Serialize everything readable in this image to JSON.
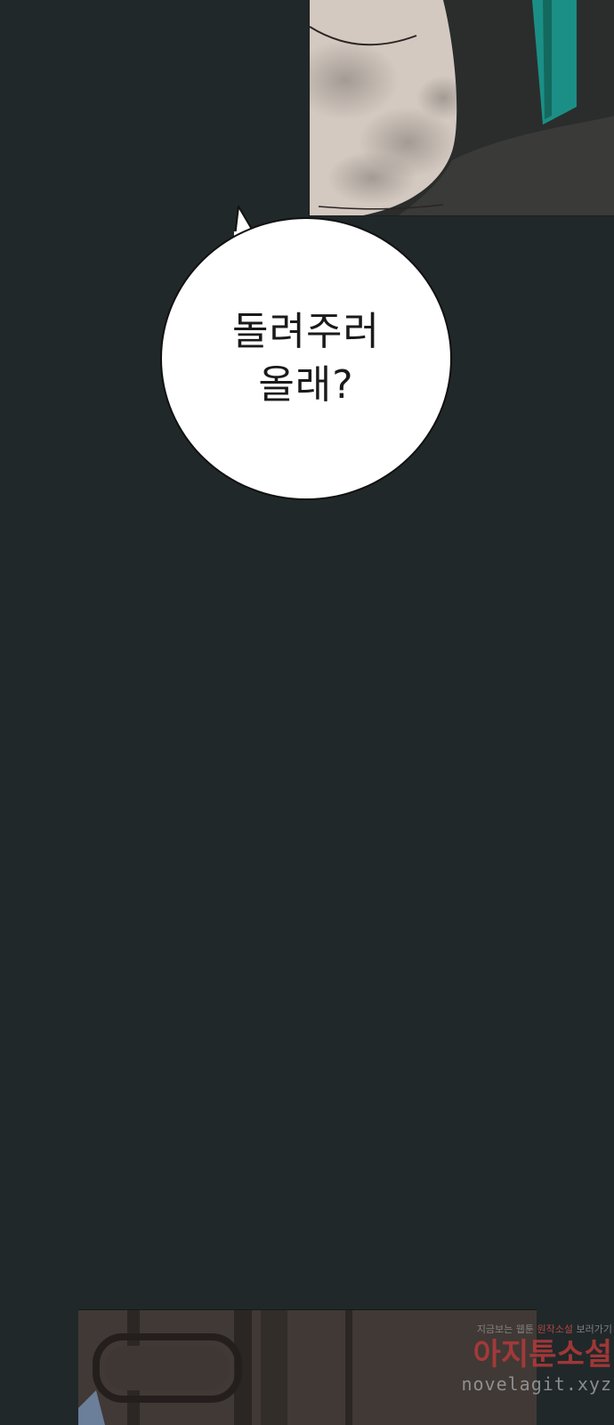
{
  "bubble": {
    "line1": "돌려주러",
    "line2": "올래?"
  },
  "watermark": {
    "tagline_pre": "지금보는 웹툰 ",
    "tagline_hl": "원작소설",
    "tagline_post": " 보러가기",
    "brand_part1": "아지툰",
    "brand_part2": "소설",
    "url": "novelagit.xyz"
  },
  "colors": {
    "background": "#212829",
    "bubble_fill": "#ffffff",
    "watermark_red": "#b53a3a"
  }
}
